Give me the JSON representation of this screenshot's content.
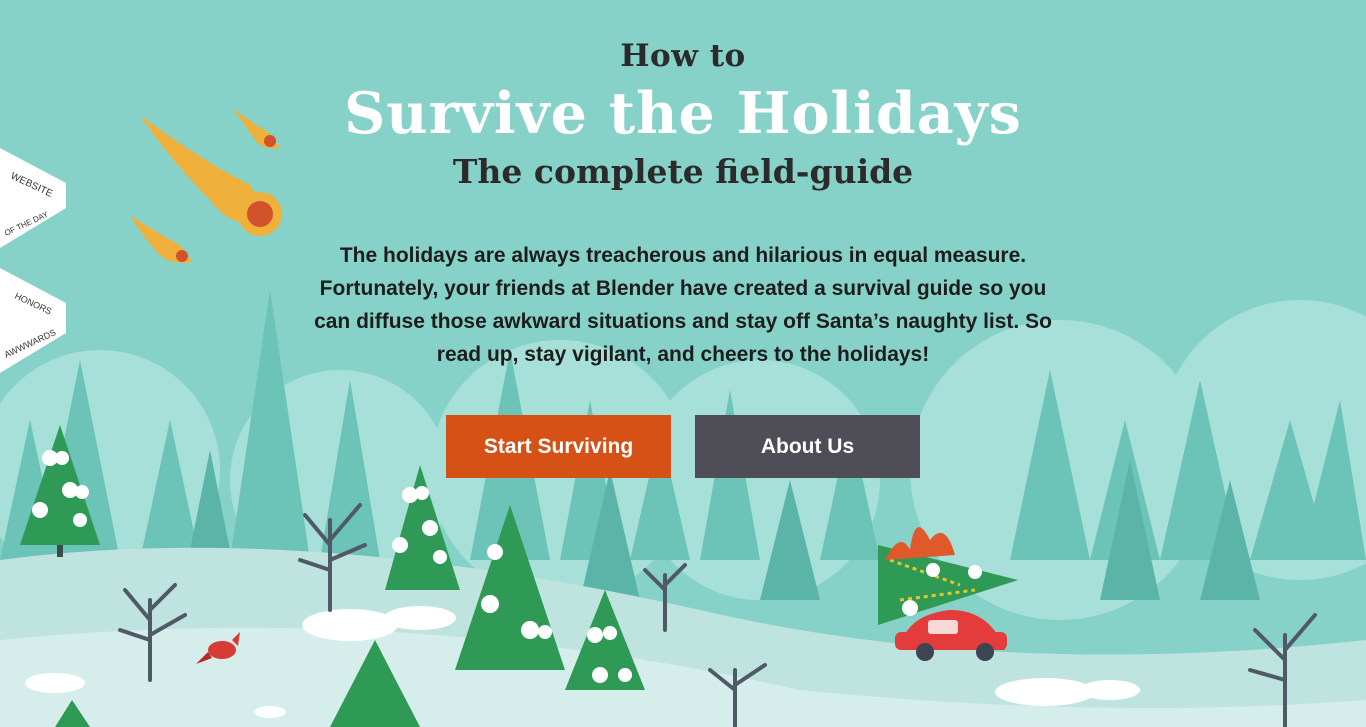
{
  "hero": {
    "kicker": "How to",
    "title": "Survive the Holidays",
    "subtitle": "The complete field-guide",
    "intro": "The holidays are always treacherous and hilarious in equal measure. Fortunately, your friends at Blender have created a survival guide so you can diffuse those awkward situations and stay off Santa’s naughty list. So read up, stay vigilant, and cheers to the holidays!"
  },
  "buttons": {
    "start_label": "Start Surviving",
    "about_label": "About Us"
  },
  "badge": {
    "line1": "WEBSITE",
    "line2": "OF THE DAY",
    "line3": "HONORS",
    "line4": "AWWWARDS"
  },
  "colors": {
    "sky": "#86d2c8",
    "start_button": "#d65115",
    "about_button": "#4f4d55",
    "title": "#ffffff",
    "heading_dark": "#2c2a2b"
  }
}
